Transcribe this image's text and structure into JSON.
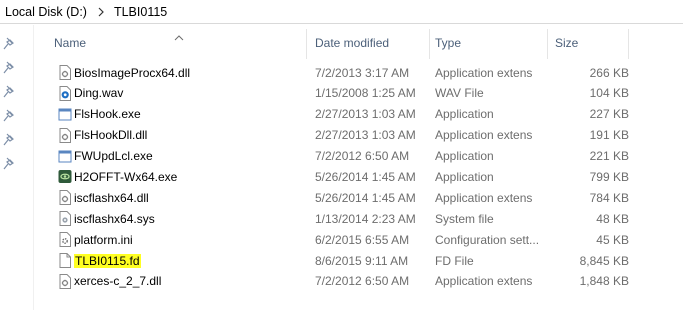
{
  "breadcrumb": {
    "items": [
      "Local Disk (D:)",
      "TLBI0115"
    ]
  },
  "columns": {
    "name": "Name",
    "date": "Date modified",
    "type": "Type",
    "size": "Size"
  },
  "files": [
    {
      "name": "BiosImageProcx64.dll",
      "date": "7/2/2013 3:17 AM",
      "type": "Application extens",
      "size": "266 KB",
      "icon": "dll-icon"
    },
    {
      "name": "Ding.wav",
      "date": "1/15/2008 1:25 AM",
      "type": "WAV File",
      "size": "104 KB",
      "icon": "audio-file-icon"
    },
    {
      "name": "FlsHook.exe",
      "date": "2/27/2013 1:03 AM",
      "type": "Application",
      "size": "227 KB",
      "icon": "exe-icon"
    },
    {
      "name": "FlsHookDll.dll",
      "date": "2/27/2013 1:03 AM",
      "type": "Application extens",
      "size": "191 KB",
      "icon": "dll-icon"
    },
    {
      "name": "FWUpdLcl.exe",
      "date": "7/2/2012 6:50 AM",
      "type": "Application",
      "size": "221 KB",
      "icon": "exe-icon"
    },
    {
      "name": "H2OFFT-Wx64.exe",
      "date": "5/26/2014 1:45 AM",
      "type": "Application",
      "size": "799 KB",
      "icon": "insyde-app-icon"
    },
    {
      "name": "iscflashx64.dll",
      "date": "5/26/2014 1:45 AM",
      "type": "Application extens",
      "size": "784 KB",
      "icon": "dll-icon"
    },
    {
      "name": "iscflashx64.sys",
      "date": "1/13/2014 2:23 AM",
      "type": "System file",
      "size": "48 KB",
      "icon": "system-file-icon"
    },
    {
      "name": "platform.ini",
      "date": "6/2/2015 6:55 AM",
      "type": "Configuration sett...",
      "size": "45 KB",
      "icon": "config-file-icon"
    },
    {
      "name": "TLBI0115.fd",
      "date": "8/6/2015 9:11 AM",
      "type": "FD File",
      "size": "8,845 KB",
      "icon": "blank-file-icon",
      "highlighted": true
    },
    {
      "name": "xerces-c_2_7.dll",
      "date": "7/2/2012 6:50 AM",
      "type": "Application extens",
      "size": "1,848 KB",
      "icon": "dll-icon"
    }
  ],
  "colors": {
    "header_text": "#4c607a",
    "highlight": "#ffff22",
    "secondary_text": "#6d6d6d"
  }
}
